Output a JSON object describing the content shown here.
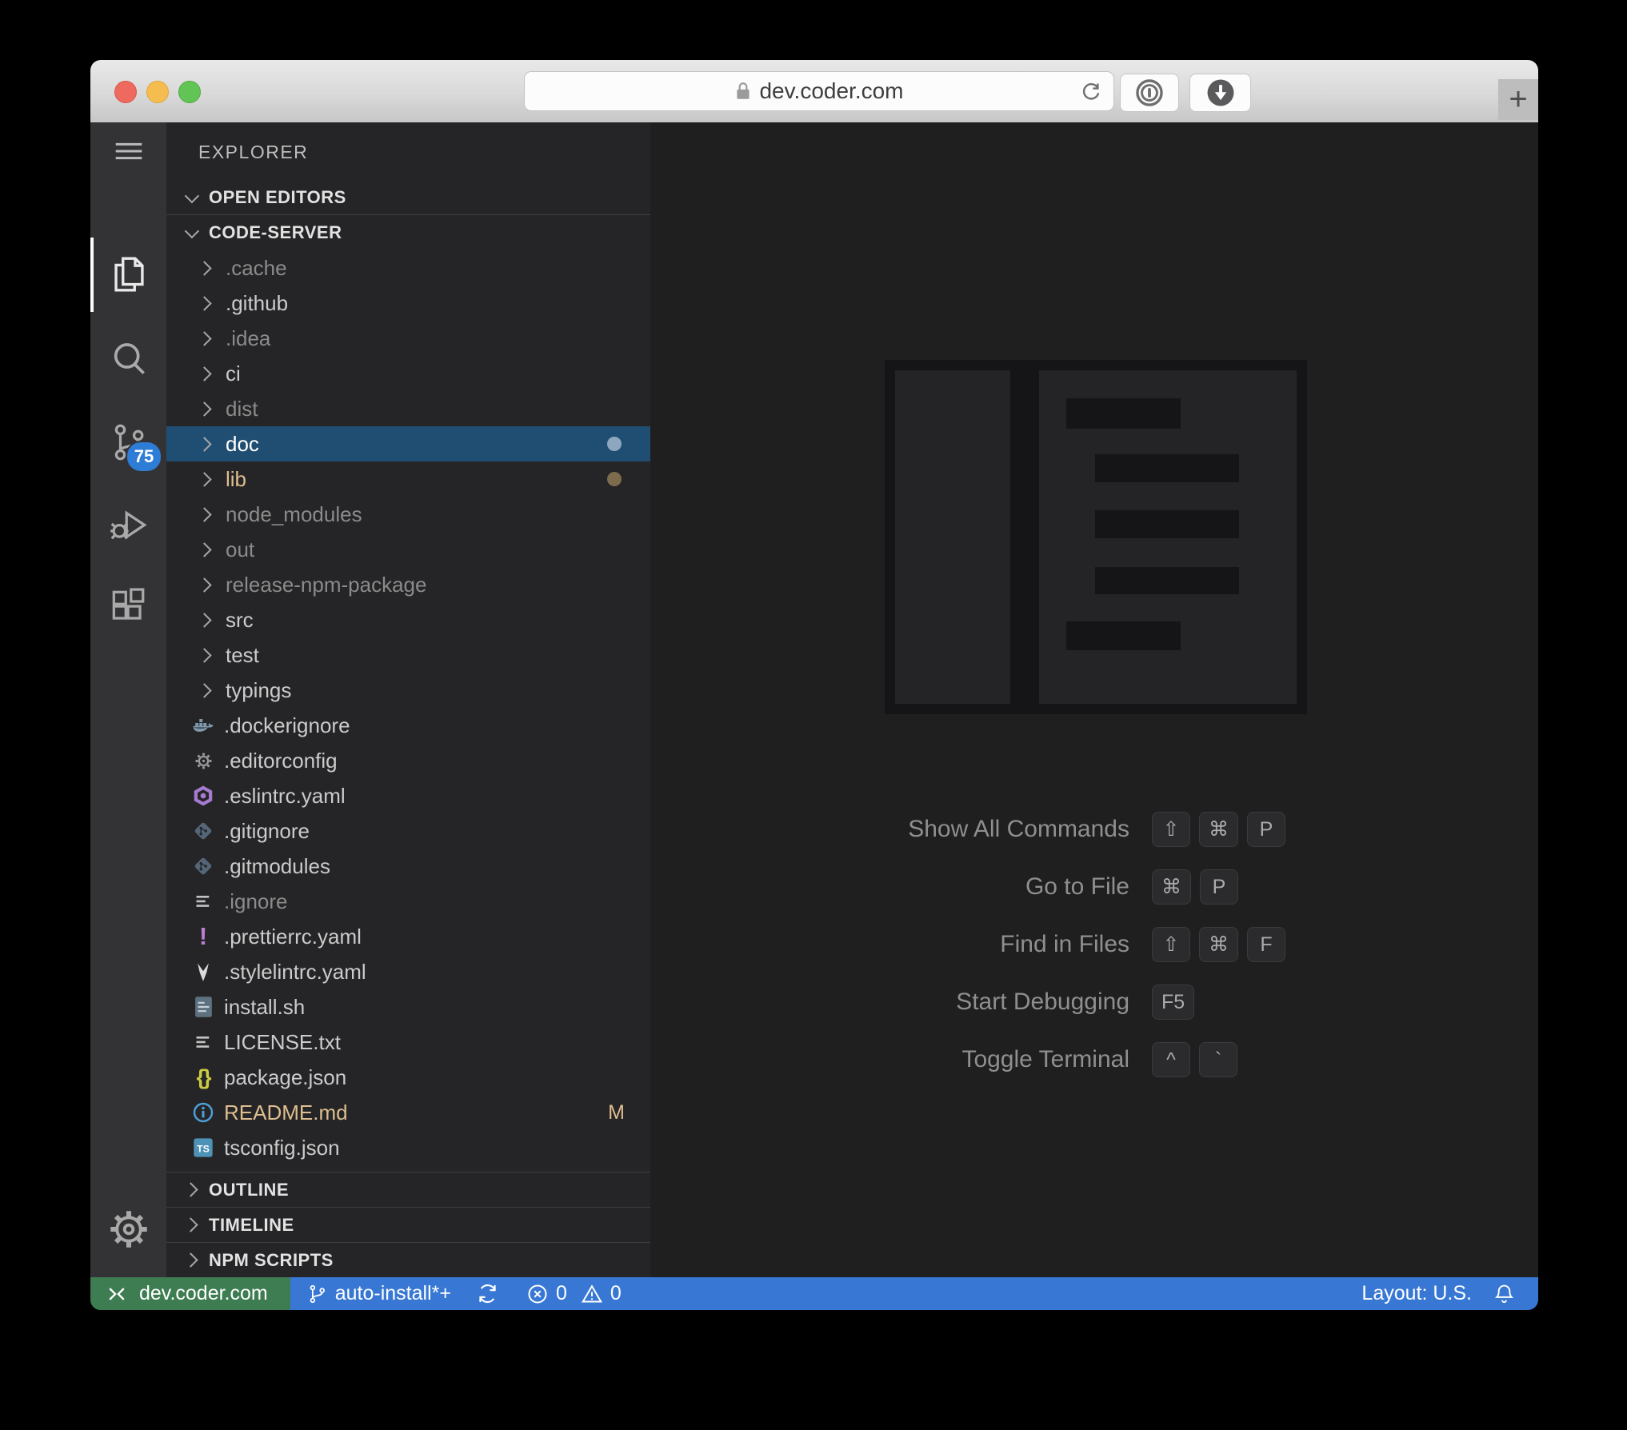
{
  "browser": {
    "address": "dev.coder.com",
    "new_tab": "+",
    "buttons": [
      {
        "name": "reload",
        "icon": "reload-icon"
      },
      {
        "name": "onepassword-extension",
        "icon": "onepassword-icon"
      },
      {
        "name": "downloads",
        "icon": "download-icon"
      }
    ]
  },
  "activity_bar": {
    "badge": "75",
    "items": [
      {
        "name": "menu",
        "icon": "hamburger-icon"
      },
      {
        "name": "explorer",
        "icon": "files-icon",
        "active": true
      },
      {
        "name": "search",
        "icon": "search-icon"
      },
      {
        "name": "source-control",
        "icon": "branch-icon",
        "badge": "75"
      },
      {
        "name": "run-debug",
        "icon": "debug-icon"
      },
      {
        "name": "extensions",
        "icon": "extensions-icon"
      }
    ],
    "bottom_items": [
      {
        "name": "settings",
        "icon": "gear-icon"
      }
    ]
  },
  "sidebar": {
    "title": "EXPLORER",
    "sections": [
      {
        "label": "OPEN EDITORS"
      },
      {
        "label": "CODE-SERVER"
      }
    ],
    "tree": [
      {
        "name": ".cache",
        "kind": "folder",
        "state": "dim"
      },
      {
        "name": ".github",
        "kind": "folder",
        "state": "normal"
      },
      {
        "name": ".idea",
        "kind": "folder",
        "state": "dim"
      },
      {
        "name": "ci",
        "kind": "folder",
        "state": "normal"
      },
      {
        "name": "dist",
        "kind": "folder",
        "state": "dim"
      },
      {
        "name": "doc",
        "kind": "folder",
        "state": "selected",
        "dot_color": "#8CA7BE"
      },
      {
        "name": "lib",
        "kind": "folder",
        "state": "modified",
        "dot_color": "#7D6B4D"
      },
      {
        "name": "node_modules",
        "kind": "folder",
        "state": "dim"
      },
      {
        "name": "out",
        "kind": "folder",
        "state": "dim"
      },
      {
        "name": "release-npm-package",
        "kind": "folder",
        "state": "dim"
      },
      {
        "name": "src",
        "kind": "folder",
        "state": "normal"
      },
      {
        "name": "test",
        "kind": "folder",
        "state": "normal"
      },
      {
        "name": "typings",
        "kind": "folder",
        "state": "normal"
      },
      {
        "name": ".dockerignore",
        "kind": "file",
        "icon": "docker",
        "state": "normal"
      },
      {
        "name": ".editorconfig",
        "kind": "file",
        "icon": "gear",
        "state": "normal"
      },
      {
        "name": ".eslintrc.yaml",
        "kind": "file",
        "icon": "eslint",
        "state": "normal"
      },
      {
        "name": ".gitignore",
        "kind": "file",
        "icon": "git",
        "state": "normal"
      },
      {
        "name": ".gitmodules",
        "kind": "file",
        "icon": "git",
        "state": "normal"
      },
      {
        "name": ".ignore",
        "kind": "file",
        "icon": "lines",
        "state": "dim"
      },
      {
        "name": ".prettierrc.yaml",
        "kind": "file",
        "icon": "prettier",
        "state": "normal"
      },
      {
        "name": ".stylelintrc.yaml",
        "kind": "file",
        "icon": "stylelint",
        "state": "normal"
      },
      {
        "name": "install.sh",
        "kind": "file",
        "icon": "shell",
        "state": "normal"
      },
      {
        "name": "LICENSE.txt",
        "kind": "file",
        "icon": "lines",
        "state": "normal"
      },
      {
        "name": "package.json",
        "kind": "file",
        "icon": "braces",
        "state": "normal"
      },
      {
        "name": "README.md",
        "kind": "file",
        "icon": "info",
        "state": "modified",
        "badge": "M"
      },
      {
        "name": "tsconfig.json",
        "kind": "file",
        "icon": "ts",
        "state": "normal"
      }
    ],
    "bottom_sections": [
      {
        "label": "OUTLINE"
      },
      {
        "label": "TIMELINE"
      },
      {
        "label": "NPM SCRIPTS"
      }
    ]
  },
  "editor": {
    "shortcuts": [
      {
        "label": "Show All Commands",
        "keys": [
          "⇧",
          "⌘",
          "P"
        ]
      },
      {
        "label": "Go to File",
        "keys": [
          "⌘",
          "P"
        ]
      },
      {
        "label": "Find in Files",
        "keys": [
          "⇧",
          "⌘",
          "F"
        ]
      },
      {
        "label": "Start Debugging",
        "keys": [
          "F5"
        ]
      },
      {
        "label": "Toggle Terminal",
        "keys": [
          "^",
          "`"
        ]
      }
    ]
  },
  "status_bar": {
    "remote": "dev.coder.com",
    "branch": "auto-install*+",
    "errors": "0",
    "warnings": "0",
    "layout": "Layout: U.S."
  },
  "colors": {
    "selection_background": "#204E72",
    "status_blue": "#3878D4",
    "remote_green": "#3E7C52",
    "scm_badge_blue": "#2D7CD6",
    "modified_text": "#DEBE8F",
    "dim_text": "#8B8B8B",
    "normal_text": "#CBCBCB",
    "doc_dot": "#8CA7BE",
    "lib_dot": "#7D6B4D",
    "activity_bar": "#333335",
    "sidebar": "#252527",
    "editor": "#1F1F20"
  }
}
